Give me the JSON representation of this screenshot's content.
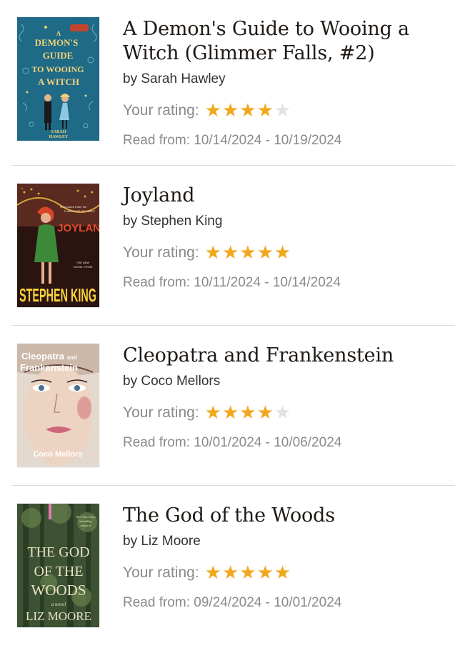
{
  "books": [
    {
      "title": "A Demon's Guide to Wooing a Witch (Glimmer Falls, #2)",
      "author": "by Sarah Hawley",
      "rating_label": "Your rating:",
      "rating": 4,
      "max_rating": 5,
      "dates": "Read from: 10/14/2024 - 10/19/2024",
      "cover": {
        "lines": [
          "A",
          "DEMON'S",
          "GUIDE",
          "TO WOOING",
          "A WITCH"
        ],
        "author": [
          "SARAH",
          "HAWLEY"
        ],
        "bg": "#1f6a86",
        "text": "#f3d27a"
      }
    },
    {
      "title": "Joyland",
      "author": "by Stephen King",
      "rating_label": "Your rating:",
      "rating": 5,
      "max_rating": 5,
      "dates": "Read from: 10/11/2024 - 10/14/2024",
      "cover": {
        "title": "JOYLAND",
        "tag": "THE NEW NOVEL FROM",
        "author": [
          "STEPHEN",
          "KING"
        ],
        "bg": "#2a1410",
        "accent": "#e34a2c",
        "text": "#f7d23a"
      }
    },
    {
      "title": "Cleopatra and Frankenstein",
      "author": "by Coco Mellors",
      "rating_label": "Your rating:",
      "rating": 4,
      "max_rating": 5,
      "dates": "Read from: 10/01/2024 - 10/06/2024",
      "cover": {
        "title": [
          "Cleopatra and",
          "Frankenstein"
        ],
        "author": "Coco Mellors",
        "bg": "#e3d9cf"
      }
    },
    {
      "title": "The God of the Woods",
      "author": "by Liz Moore",
      "rating_label": "Your rating:",
      "rating": 5,
      "max_rating": 5,
      "dates": "Read from: 09/24/2024 - 10/01/2024",
      "cover": {
        "title": [
          "THE GOD",
          "OF THE",
          "WOODS"
        ],
        "author": "LIZ MOORE",
        "bg": "#3c5233"
      }
    }
  ],
  "colors": {
    "star_on": "#f0a81c",
    "star_off": "#e2e2e2",
    "divider": "#dcdcdc"
  }
}
